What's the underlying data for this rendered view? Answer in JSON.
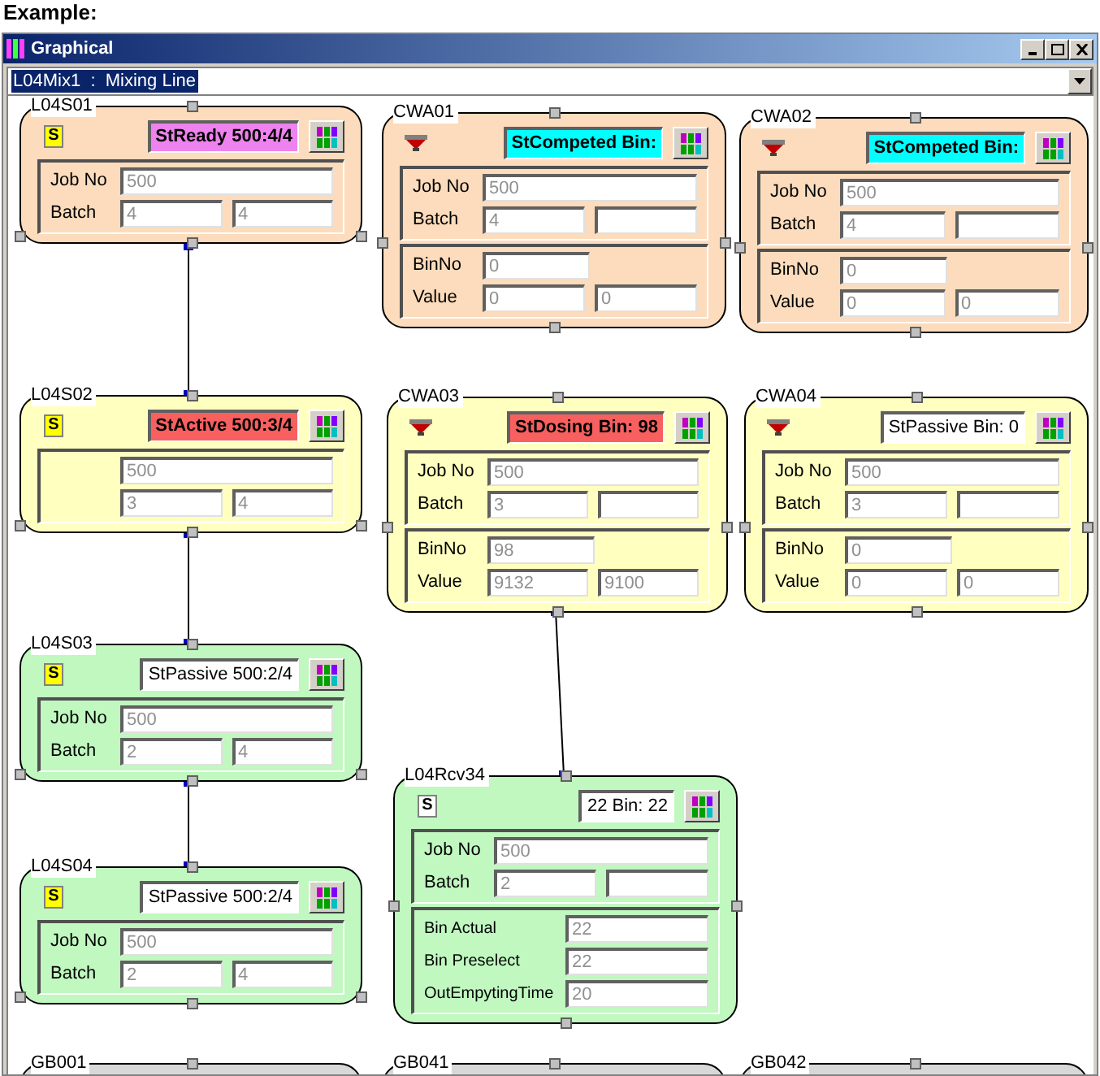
{
  "heading": "Example:",
  "window": {
    "title": "Graphical",
    "line_select": {
      "value": "L04Mix1  :  Mixing Line"
    }
  },
  "nodes": [
    {
      "name": "L04S01",
      "color": "#fcdcbc",
      "icon": {
        "kind": "station",
        "text": "S",
        "color": "#ffff00"
      },
      "status": {
        "text": "StReady 500:4/4",
        "color": "#ee82ee",
        "alert": true
      },
      "sections": [
        {
          "rows": [
            {
              "kind": "single",
              "label": "Job No",
              "values": [
                "500"
              ]
            },
            {
              "kind": "pair",
              "label": "Batch",
              "values": [
                "4",
                "4"
              ]
            }
          ]
        }
      ]
    },
    {
      "name": "CWA01",
      "color": "#fcdcbc",
      "icon": {
        "kind": "hopper"
      },
      "status": {
        "text": "StCompeted Bin:",
        "color": "#00ffff",
        "alert": true
      },
      "sections": [
        {
          "rows": [
            {
              "kind": "single",
              "label": "Job No",
              "values": [
                "500"
              ]
            },
            {
              "kind": "pair",
              "label": "Batch",
              "values": [
                "4"
              ]
            }
          ]
        },
        {
          "rows": [
            {
              "kind": "half",
              "label": "BinNo",
              "values": [
                "0"
              ]
            },
            {
              "kind": "pair",
              "label": "Value",
              "values": [
                "0",
                "0"
              ]
            }
          ]
        }
      ]
    },
    {
      "name": "CWA02",
      "color": "#fcdcbc",
      "icon": {
        "kind": "hopper"
      },
      "status": {
        "text": "StCompeted Bin:",
        "color": "#00ffff",
        "alert": true
      },
      "sections": [
        {
          "rows": [
            {
              "kind": "single",
              "label": "Job No",
              "values": [
                "500"
              ]
            },
            {
              "kind": "pair",
              "label": "Batch",
              "values": [
                "4"
              ]
            }
          ]
        },
        {
          "rows": [
            {
              "kind": "half",
              "label": "BinNo",
              "values": [
                "0"
              ]
            },
            {
              "kind": "pair",
              "label": "Value",
              "values": [
                "0",
                "0"
              ]
            }
          ]
        }
      ]
    },
    {
      "name": "L04S02",
      "color": "#ffffc0",
      "icon": {
        "kind": "station",
        "text": "S",
        "color": "#ffff00"
      },
      "status": {
        "text": "StActive 500:3/4",
        "color": "#f86060",
        "alert": true
      },
      "sections": [
        {
          "rows": [
            {
              "kind": "single",
              "values": [
                "500"
              ]
            },
            {
              "kind": "pair",
              "values": [
                "3",
                "4"
              ]
            }
          ]
        }
      ]
    },
    {
      "name": "CWA03",
      "color": "#ffffc0",
      "icon": {
        "kind": "hopper"
      },
      "status": {
        "text": "StDosing Bin: 98",
        "color": "#f86060",
        "alert": true
      },
      "sections": [
        {
          "rows": [
            {
              "kind": "single",
              "label": "Job No",
              "values": [
                "500"
              ]
            },
            {
              "kind": "pair",
              "label": "Batch",
              "values": [
                "3"
              ]
            }
          ]
        },
        {
          "rows": [
            {
              "kind": "half",
              "label": "BinNo",
              "values": [
                "98"
              ]
            },
            {
              "kind": "pair",
              "label": "Value",
              "values": [
                "9132",
                "9100"
              ]
            }
          ]
        }
      ]
    },
    {
      "name": "CWA04",
      "color": "#ffffc0",
      "icon": {
        "kind": "hopper"
      },
      "status": {
        "text": "StPassive Bin: 0",
        "color": "#ffffff",
        "alert": false
      },
      "sections": [
        {
          "rows": [
            {
              "kind": "single",
              "label": "Job No",
              "values": [
                "500"
              ]
            },
            {
              "kind": "pair",
              "label": "Batch",
              "values": [
                "3"
              ]
            }
          ]
        },
        {
          "rows": [
            {
              "kind": "half",
              "label": "BinNo",
              "values": [
                "0"
              ]
            },
            {
              "kind": "pair",
              "label": "Value",
              "values": [
                "0",
                "0"
              ]
            }
          ]
        }
      ]
    },
    {
      "name": "L04S03",
      "color": "#c0f8c0",
      "icon": {
        "kind": "station",
        "text": "S",
        "color": "#ffff00"
      },
      "status": {
        "text": "StPassive 500:2/4",
        "color": "#ffffff",
        "alert": false
      },
      "sections": [
        {
          "rows": [
            {
              "kind": "single",
              "label": "Job No",
              "values": [
                "500"
              ]
            },
            {
              "kind": "pair",
              "label": "Batch",
              "values": [
                "2",
                "4"
              ]
            }
          ]
        }
      ]
    },
    {
      "name": "L04S04",
      "color": "#c0f8c0",
      "icon": {
        "kind": "station",
        "text": "S",
        "color": "#ffff00"
      },
      "status": {
        "text": "StPassive 500:2/4",
        "color": "#ffffff",
        "alert": false
      },
      "sections": [
        {
          "rows": [
            {
              "kind": "single",
              "label": "Job No",
              "values": [
                "500"
              ]
            },
            {
              "kind": "pair",
              "label": "Batch",
              "values": [
                "2",
                "4"
              ]
            }
          ]
        }
      ]
    },
    {
      "name": "L04Rcv34",
      "color": "#c0f8c0",
      "icon": {
        "kind": "station",
        "text": "S",
        "color": "#ffffff"
      },
      "status": {
        "text": "22 Bin: 22",
        "color": "#ffffff",
        "alert": false
      },
      "sections": [
        {
          "rows": [
            {
              "kind": "single",
              "label": "Job No",
              "values": [
                "500"
              ]
            },
            {
              "kind": "pair",
              "label": "Batch",
              "values": [
                "2"
              ]
            }
          ]
        },
        {
          "rows": [
            {
              "kind": "wide",
              "label": "Bin Actual",
              "values": [
                "22"
              ]
            },
            {
              "kind": "wide",
              "label": "Bin Preselect",
              "values": [
                "22"
              ]
            },
            {
              "kind": "wide",
              "label": "OutEmpytingTime",
              "values": [
                "20"
              ]
            }
          ]
        }
      ]
    },
    {
      "name": "GB001",
      "color": "#d8d8d8"
    },
    {
      "name": "GB041",
      "color": "#d8d8d8"
    },
    {
      "name": "GB042",
      "color": "#d8d8d8"
    }
  ]
}
